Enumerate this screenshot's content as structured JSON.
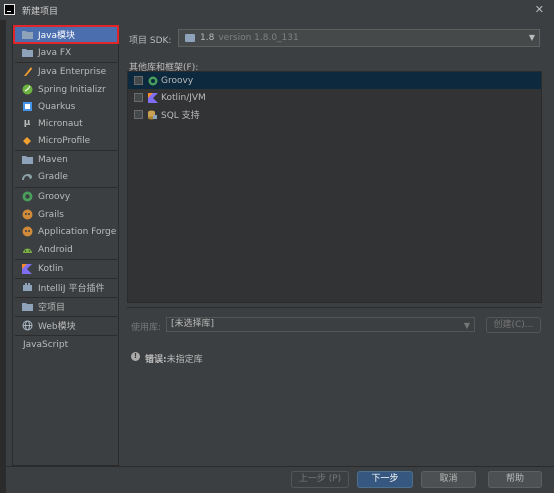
{
  "window": {
    "title": "新建项目",
    "close_glyph": "✕"
  },
  "sidebar": {
    "items": [
      {
        "label": "Java模块",
        "icon": "folder-icon"
      },
      {
        "label": "Java FX",
        "icon": "folder-icon"
      },
      {
        "label": "Java Enterprise",
        "icon": "java-enterprise-icon"
      },
      {
        "label": "Spring Initializr",
        "icon": "spring-icon"
      },
      {
        "label": "Quarkus",
        "icon": "quarkus-icon"
      },
      {
        "label": "Micronaut",
        "icon": "micronaut-icon"
      },
      {
        "label": "MicroProfile",
        "icon": "microprofile-icon"
      },
      {
        "label": "Maven",
        "icon": "maven-icon"
      },
      {
        "label": "Gradle",
        "icon": "gradle-icon"
      },
      {
        "label": "Groovy",
        "icon": "groovy-icon"
      },
      {
        "label": "Grails",
        "icon": "grails-icon"
      },
      {
        "label": "Application Forge",
        "icon": "application-forge-icon"
      },
      {
        "label": "Android",
        "icon": "android-icon"
      },
      {
        "label": "Kotlin",
        "icon": "kotlin-icon"
      },
      {
        "label": "IntelliJ 平台插件",
        "icon": "intellij-plugin-icon"
      },
      {
        "label": "空项目",
        "icon": "folder-icon"
      },
      {
        "label": "Web模块",
        "icon": "globe-icon"
      },
      {
        "label": "JavaScript",
        "icon": ""
      }
    ]
  },
  "sdk": {
    "label": "项目 SDK:",
    "value": "1.8",
    "version": "version 1.8.0_131"
  },
  "frameworks": {
    "label": "其他库和框架(F):",
    "items": [
      {
        "label": "Groovy",
        "icon": "groovy-icon",
        "checked": false
      },
      {
        "label": "Kotlin/JVM",
        "icon": "kotlin-icon",
        "checked": false
      },
      {
        "label": "SQL 支持",
        "icon": "sql-icon",
        "checked": false
      }
    ]
  },
  "library": {
    "label": "使用库:",
    "value": "[未选择库]",
    "create_button": "创建(C)..."
  },
  "error": {
    "label": "错误:",
    "message": "未指定库"
  },
  "buttons": {
    "prev": "上一步 (P)",
    "next": "下一步",
    "cancel": "取消",
    "help": "帮助"
  },
  "colors": {
    "background": "#3c3f41",
    "selection": "#4b6eaf",
    "highlight_outline": "#e0262a",
    "primary_button": "#365880",
    "framework_selection": "#0d293e"
  }
}
